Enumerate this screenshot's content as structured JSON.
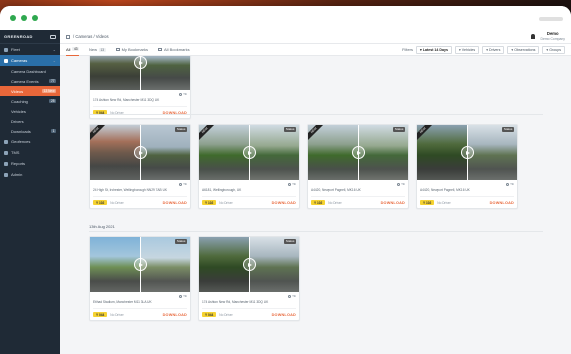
{
  "app": {
    "logo": "GREENROAD",
    "breadcrumb": "/ Cameras / Videos",
    "user_name": "Demo",
    "user_sub": "Demo Company"
  },
  "sidebar": {
    "items": [
      {
        "label": "Fleet",
        "type": "section-collapsed"
      },
      {
        "label": "Cameras",
        "type": "section-open"
      },
      {
        "label": "Camera Dashboard",
        "type": "sub"
      },
      {
        "label": "Camera Events",
        "type": "sub",
        "badge": "77"
      },
      {
        "label": "Videos",
        "type": "sub-active",
        "badge": "13 New"
      },
      {
        "label": "Coaching",
        "type": "sub",
        "badge": "25"
      },
      {
        "label": "Vehicles",
        "type": "sub"
      },
      {
        "label": "Drivers",
        "type": "sub"
      },
      {
        "label": "Downloads",
        "type": "sub",
        "badge": "1"
      },
      {
        "label": "Geofences",
        "type": "item"
      },
      {
        "label": "TMS",
        "type": "item"
      },
      {
        "label": "Reports",
        "type": "item"
      },
      {
        "label": "Admin",
        "type": "item"
      }
    ]
  },
  "tabs": [
    {
      "label": "All",
      "count": "43",
      "active": true
    },
    {
      "label": "New",
      "count": "13",
      "active": false
    },
    {
      "label": "My Bookmarks",
      "count": "",
      "active": false
    },
    {
      "label": "All Bookmarks",
      "count": "",
      "active": false
    }
  ],
  "filters": {
    "label": "Filters",
    "date": "Latest 14 Days",
    "vehicles": "Vehicles",
    "drivers": "Drivers",
    "observations": "Observations",
    "groups": "Groups"
  },
  "labels": {
    "status": "Status",
    "tilt": "Tilt",
    "no_driver": "No Driver",
    "download": "DOWNLOAD",
    "ribbon": "NEW"
  },
  "date_headers": [
    "13th Aug 2021"
  ],
  "cards_row0": [
    {
      "loc": "174 Ashton New Rd, Manchester M11 3DQ UK",
      "key": "Y 044"
    }
  ],
  "cards_row1": [
    {
      "loc": "24 High St, Irchester, Wellingborough NN29 7AB UK",
      "key": "Y 102",
      "theme": "city",
      "ribbon": true
    },
    {
      "loc": "A6181, Wellingborough, UK",
      "key": "Y 102",
      "theme": "green",
      "ribbon": true
    },
    {
      "loc": "A4420, Newport Pagnell, MK16 UK",
      "key": "Y 102",
      "theme": "green",
      "ribbon": true
    },
    {
      "loc": "A4420, Newport Pagnell, MK16 UK",
      "key": "Y 102",
      "theme": "dark",
      "ribbon": true
    }
  ],
  "cards_row2": [
    {
      "loc": "Etihad Stadium, Manchester M11 3LA UK",
      "key": "Y 044",
      "theme": "sky"
    },
    {
      "loc": "174 Ashton New Rd, Manchester M11 3DQ UK",
      "key": "Y 044",
      "theme": "dark"
    }
  ],
  "colors": {
    "accent": "#e8673a",
    "sidebar": "#1f2a36",
    "badge_yellow": "#f5d231",
    "section_blue": "#2a6fa8"
  }
}
